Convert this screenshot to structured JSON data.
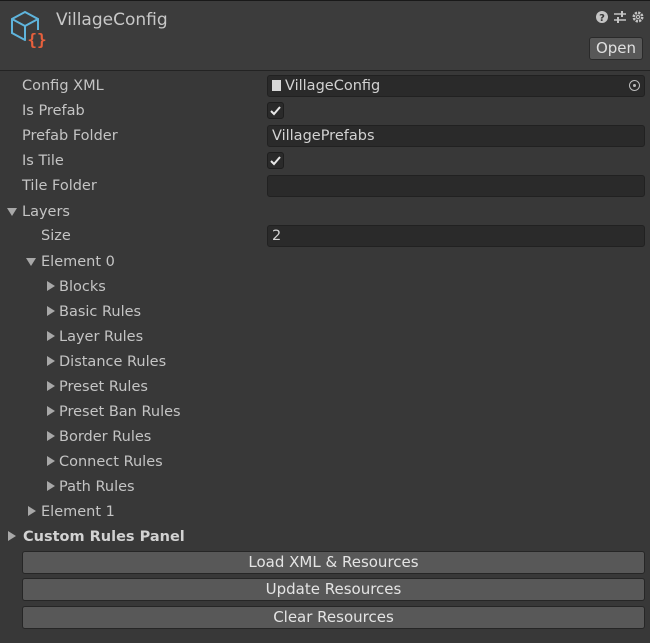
{
  "header": {
    "title": "VillageConfig",
    "open_label": "Open",
    "icons": [
      "help-icon",
      "preset-icon",
      "settings-icon"
    ]
  },
  "properties": {
    "config_xml_label": "Config XML",
    "config_xml_value": "VillageConfig",
    "is_prefab_label": "Is Prefab",
    "is_prefab_checked": true,
    "prefab_folder_label": "Prefab Folder",
    "prefab_folder_value": "VillagePrefabs",
    "is_tile_label": "Is Tile",
    "is_tile_checked": true,
    "tile_folder_label": "Tile Folder",
    "tile_folder_value": ""
  },
  "layers": {
    "label": "Layers",
    "size_label": "Size",
    "size_value": "2",
    "element0_label": "Element 0",
    "element0_children": [
      "Blocks",
      "Basic Rules",
      "Layer Rules",
      "Distance Rules",
      "Preset Rules",
      "Preset Ban Rules",
      "Border Rules",
      "Connect Rules",
      "Path Rules"
    ],
    "element1_label": "Element 1"
  },
  "custom_rules_label": "Custom Rules Panel",
  "buttons": {
    "load": "Load XML & Resources",
    "update": "Update Resources",
    "clear": "Clear Resources"
  },
  "colors": {
    "background": "#383838",
    "field": "#2a2a2a",
    "button": "#585858",
    "icon_blue": "#5fb4dc",
    "icon_orange": "#e8603c"
  }
}
